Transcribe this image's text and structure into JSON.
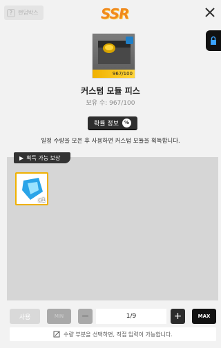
{
  "header": {
    "random_box_label": "랜덤박스",
    "rarity_label": "SSR"
  },
  "item": {
    "name": "커스텀 모듈 피스",
    "owned_text": "보유 수: 967/100",
    "frame_count": "967/100"
  },
  "probability_button": "확률 정보",
  "description": "일정 수량을 모은 후 사용하면 커스텀 모듈을 획득합니다.",
  "reward": {
    "tag_label": "획득 가능 보상",
    "items": [
      {
        "qty": "x1"
      }
    ]
  },
  "controls": {
    "use_label": "사용",
    "min_label": "MIN",
    "quantity": "1/9",
    "max_label": "MAX"
  },
  "hint": "수량 부분을 선택하면, 직접 입력이 가능합니다.",
  "colors": {
    "rarity": "#f08a1c",
    "count_bar": "#f0b100",
    "lock": "#1f7fc7"
  }
}
